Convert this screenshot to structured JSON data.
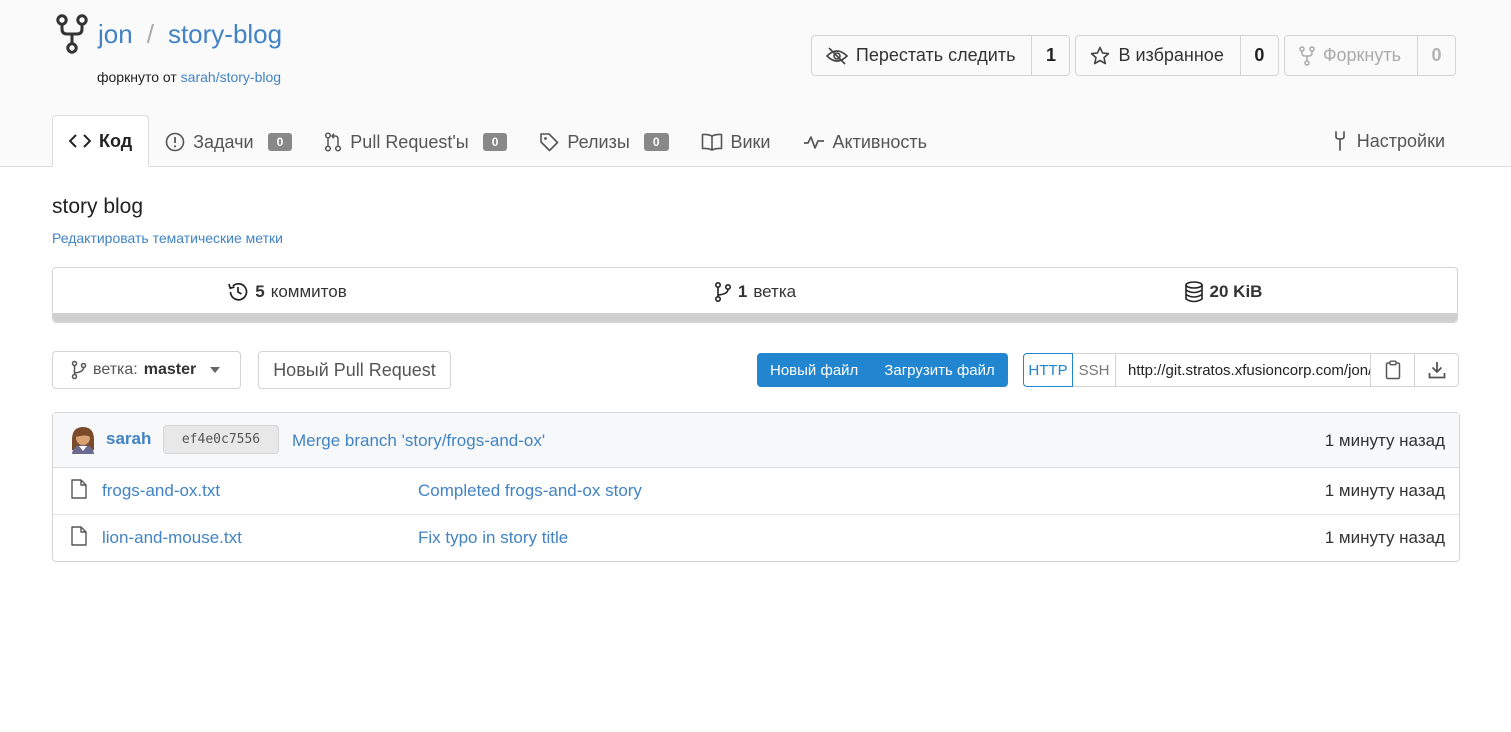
{
  "repo": {
    "owner": "jon",
    "separator": "/",
    "name": "story-blog",
    "forked_prefix": "форкнуто от",
    "forked_from": "sarah/story-blog"
  },
  "actions": {
    "watch": {
      "label": "Перестать следить",
      "count": "1"
    },
    "star": {
      "label": "В избранное",
      "count": "0"
    },
    "fork": {
      "label": "Форкнуть",
      "count": "0"
    }
  },
  "tabs": {
    "code": "Код",
    "issues": {
      "label": "Задачи",
      "count": "0"
    },
    "pulls": {
      "label": "Pull Request'ы",
      "count": "0"
    },
    "releases": {
      "label": "Релизы",
      "count": "0"
    },
    "wiki": "Вики",
    "activity": "Активность",
    "settings": "Настройки"
  },
  "description": "story blog",
  "edit_topics": "Редактировать тематические метки",
  "stats": {
    "commits_count": "5",
    "commits_label": "коммитов",
    "branches_count": "1",
    "branches_label": "ветка",
    "size": "20 KiB"
  },
  "toolbar": {
    "branch_prefix": "ветка:",
    "branch_name": "master",
    "new_pr": "Новый Pull Request",
    "new_file": "Новый файл",
    "upload_file": "Загрузить файл",
    "http": "HTTP",
    "ssh": "SSH",
    "clone_url": "http://git.stratos.xfusioncorp.com/jon/story-blog.git"
  },
  "latest_commit": {
    "author": "sarah",
    "sha": "ef4e0c7556",
    "message": "Merge branch 'story/frogs-and-ox'",
    "time": "1 минуту назад"
  },
  "files": [
    {
      "name": "frogs-and-ox.txt",
      "message": "Completed frogs-and-ox story",
      "time": "1 минуту назад"
    },
    {
      "name": "lion-and-mouse.txt",
      "message": "Fix typo in story title",
      "time": "1 минуту назад"
    }
  ],
  "colors": {
    "link": "#4183c4",
    "primary_button": "#2185d0",
    "header_bg": "#fafafa"
  }
}
